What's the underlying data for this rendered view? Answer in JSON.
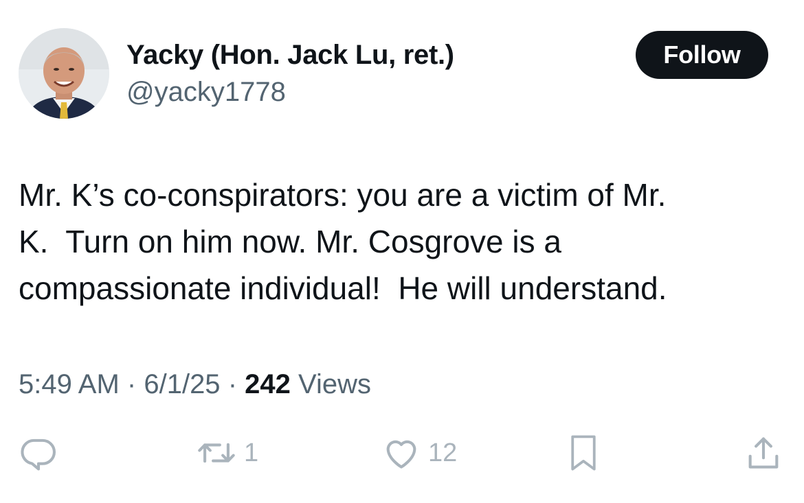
{
  "author": {
    "display_name": "Yacky (Hon. Jack Lu, ret.)",
    "handle": "@yacky1778",
    "avatar_icon": "profile-photo"
  },
  "follow_button": {
    "label": "Follow"
  },
  "tweet": {
    "text_lines": [
      "Mr. K’s co-conspirators: you are a victim of Mr.",
      "K.  Turn on him now. Mr. Cosgrove is a",
      "compassionate individual!  He will understand."
    ]
  },
  "meta": {
    "time": "5:49 AM",
    "separator": "·",
    "date": "6/1/25",
    "views_count": "242",
    "views_label": "Views"
  },
  "actions": {
    "reply": {
      "icon": "reply-icon"
    },
    "retweet": {
      "icon": "retweet-icon",
      "count": "1"
    },
    "like": {
      "icon": "heart-icon",
      "count": "12"
    },
    "bookmark": {
      "icon": "bookmark-icon"
    },
    "share": {
      "icon": "share-icon"
    }
  },
  "colors": {
    "text_primary": "#0f1419",
    "text_secondary": "#536471",
    "action_icon": "#aab4bc",
    "follow_bg": "#0f1419"
  }
}
